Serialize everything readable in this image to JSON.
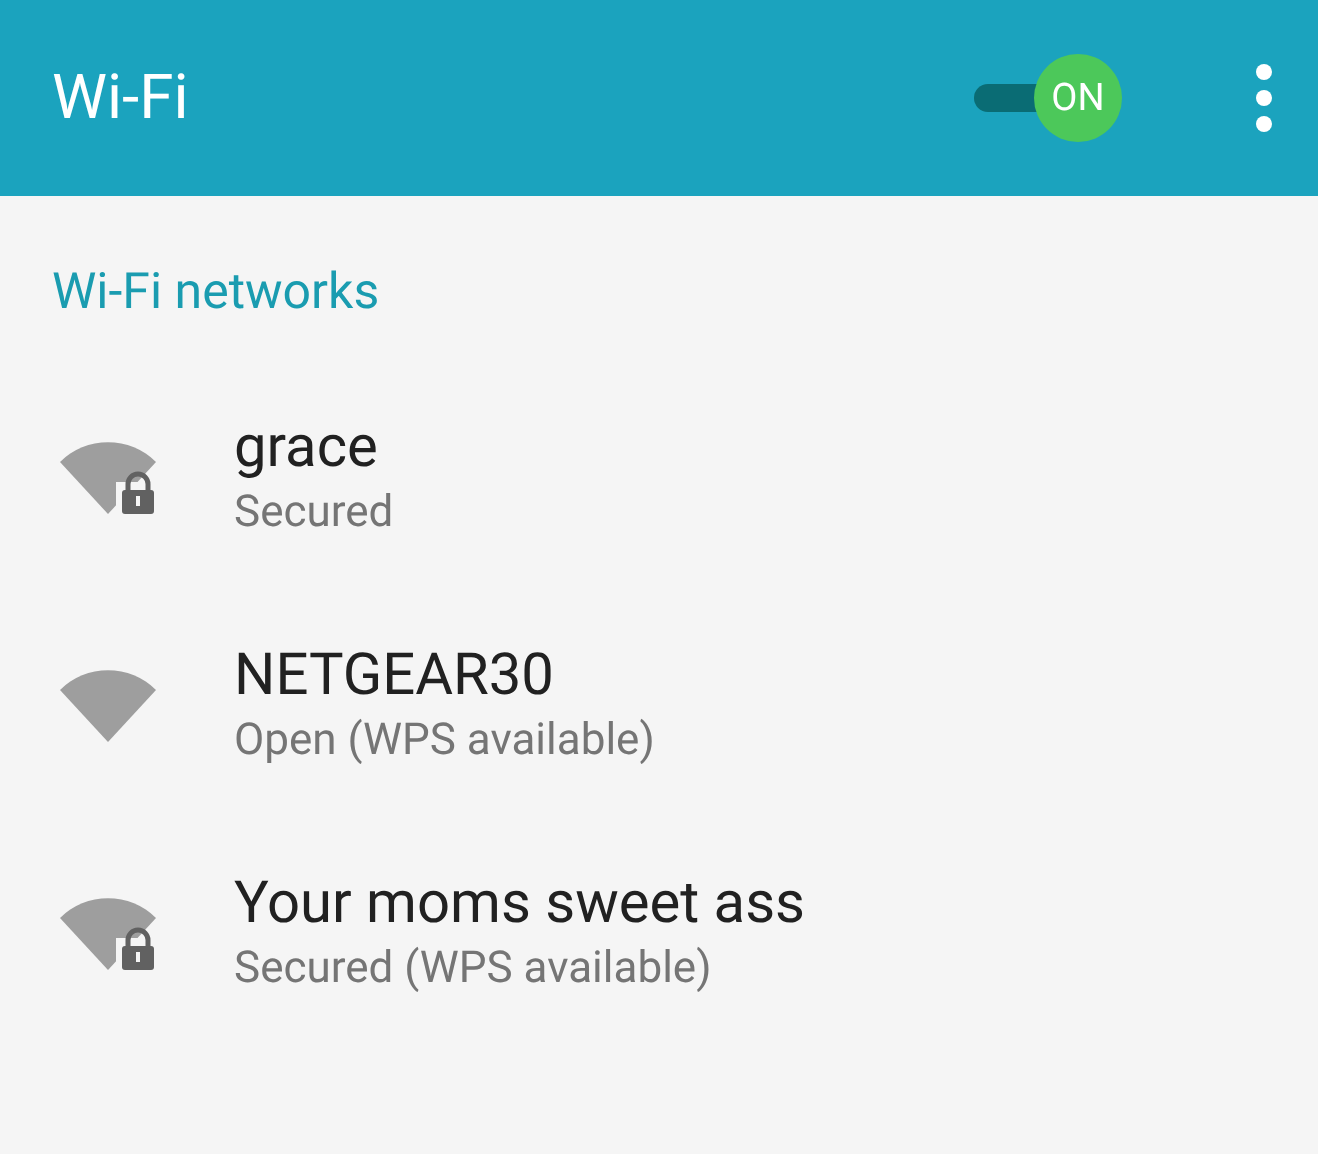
{
  "header": {
    "title": "Wi-Fi",
    "toggle": {
      "label": "ON",
      "on": true
    }
  },
  "section_title": "Wi-Fi networks",
  "networks": [
    {
      "name": "grace",
      "status": "Secured",
      "locked": true
    },
    {
      "name": "NETGEAR30",
      "status": "Open (WPS available)",
      "locked": false
    },
    {
      "name": "Your moms sweet ass",
      "status": "Secured (WPS available)",
      "locked": true
    }
  ]
}
